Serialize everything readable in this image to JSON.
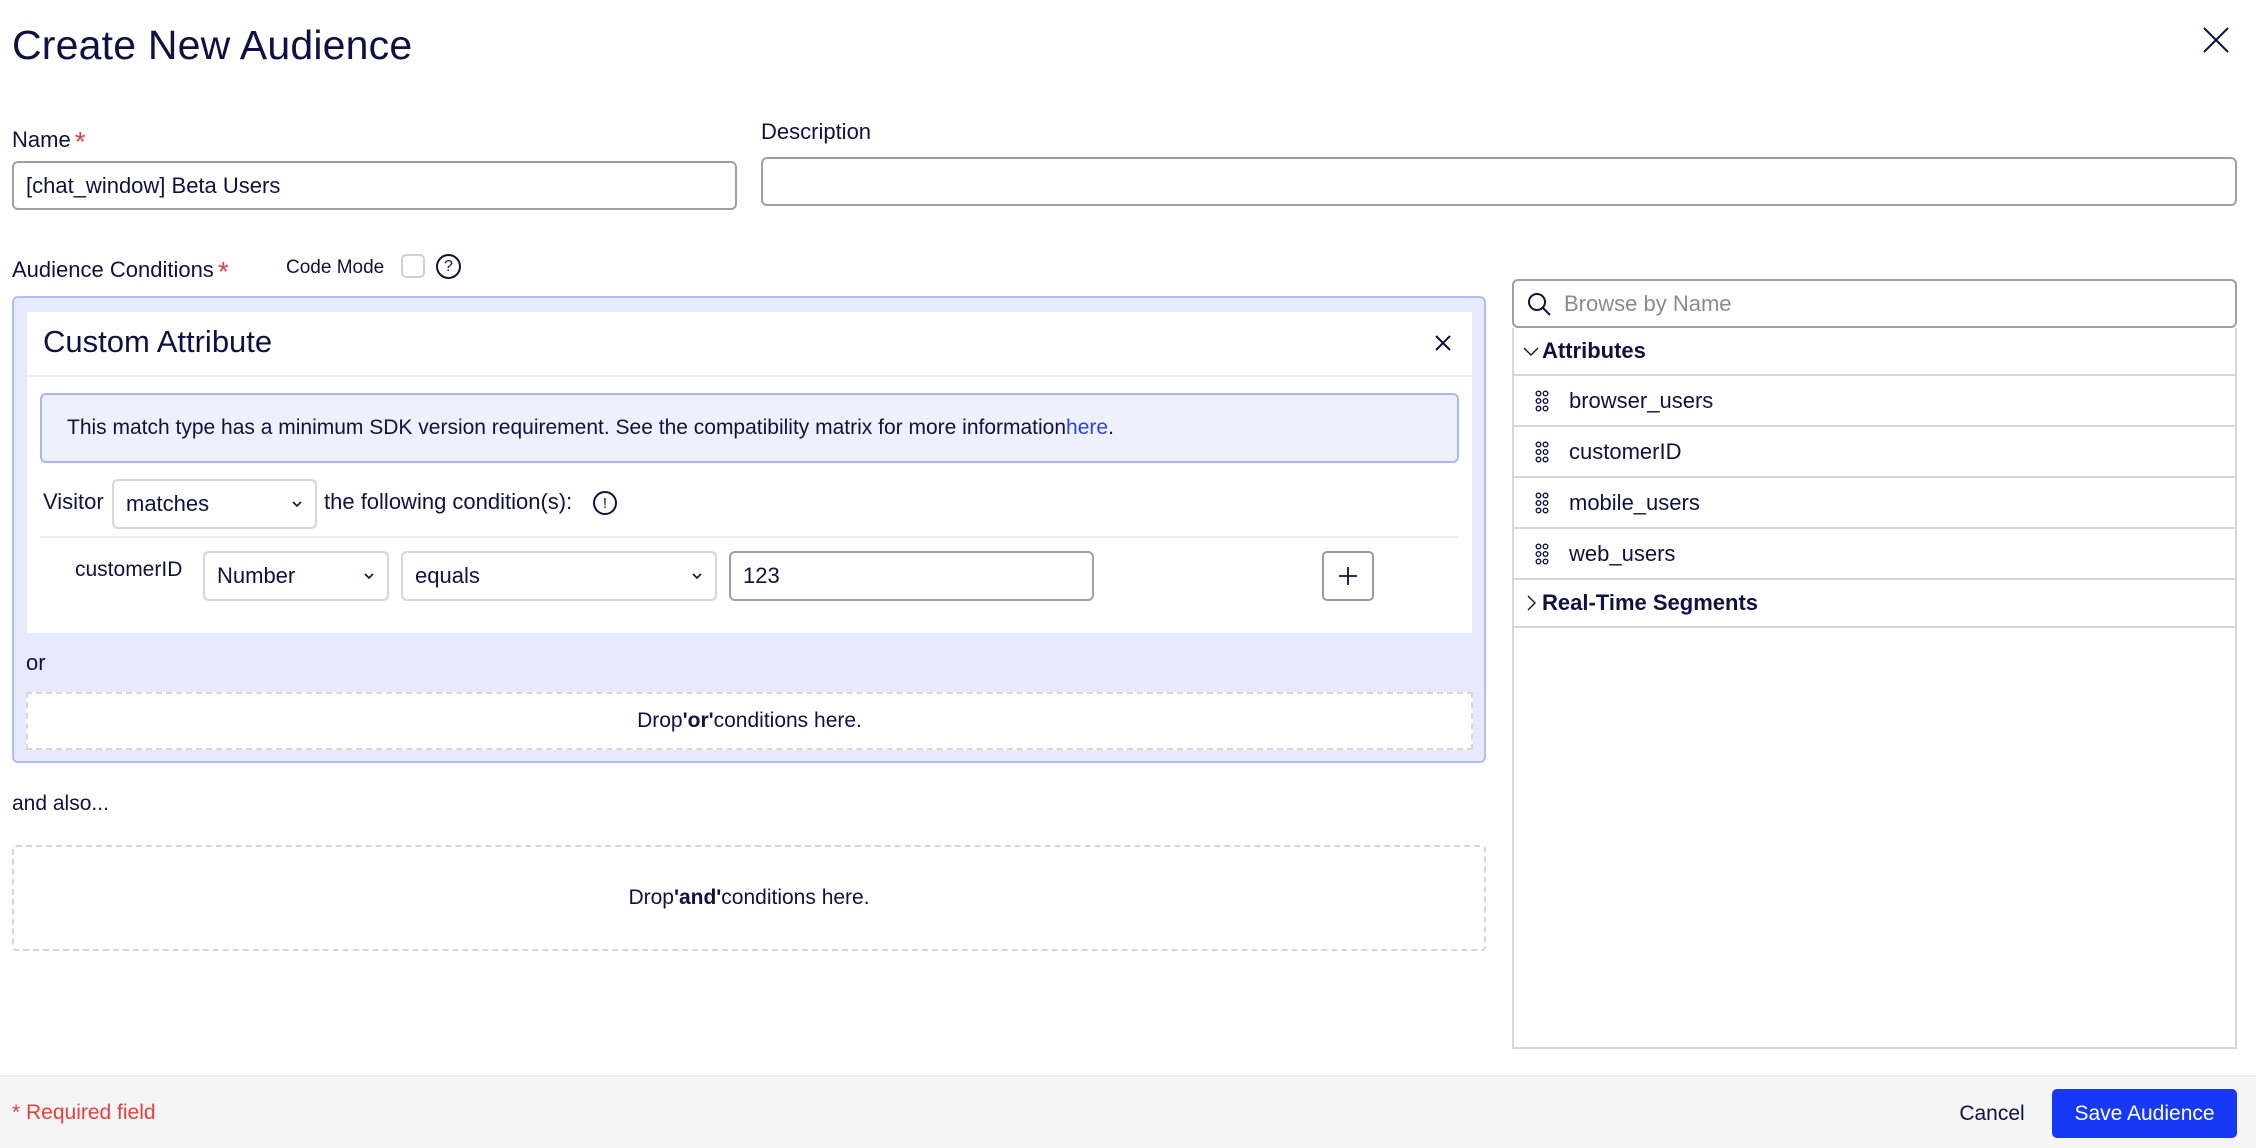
{
  "dialog": {
    "title": "Create New Audience",
    "close_icon": "close-icon"
  },
  "form": {
    "name_label": "Name",
    "required_marker": "*",
    "name_value": "[chat_window] Beta Users",
    "description_label": "Description",
    "description_value": "",
    "conditions_label": "Audience Conditions",
    "code_mode_label": "Code Mode",
    "code_mode_checked": false,
    "help_icon_glyph": "?"
  },
  "condition_card": {
    "title": "Custom Attribute",
    "alert_text": "This match type has a minimum SDK version requirement. See the compatibility matrix for more information",
    "alert_link": "here",
    "alert_suffix": ".",
    "visitor_label": "Visitor",
    "match_select": "matches",
    "following_label": "the following condition(s):",
    "warn_icon_glyph": "!",
    "condition": {
      "attribute": "customerID",
      "type": "Number",
      "operator": "equals",
      "value": "123"
    }
  },
  "or_label": "or",
  "drop_or_text": [
    "Drop ",
    "'or'",
    " conditions here."
  ],
  "and_also_label": "and also...",
  "drop_and_text": [
    "Drop ",
    "'and'",
    " conditions here."
  ],
  "browser": {
    "search_placeholder": "Browse by Name",
    "groups": [
      {
        "label": "Attributes",
        "expanded": true,
        "items": [
          "browser_users",
          "customerID",
          "mobile_users",
          "web_users"
        ]
      },
      {
        "label": "Real-Time Segments",
        "expanded": false,
        "items": []
      }
    ]
  },
  "footer": {
    "required_note": "* Required field",
    "cancel_label": "Cancel",
    "save_label": "Save Audience"
  },
  "colors": {
    "primary": "#1539f5",
    "required": "#e2403e",
    "text": "#0f1140",
    "condition_bg": "#e7eafd",
    "link": "#2a43e8"
  }
}
